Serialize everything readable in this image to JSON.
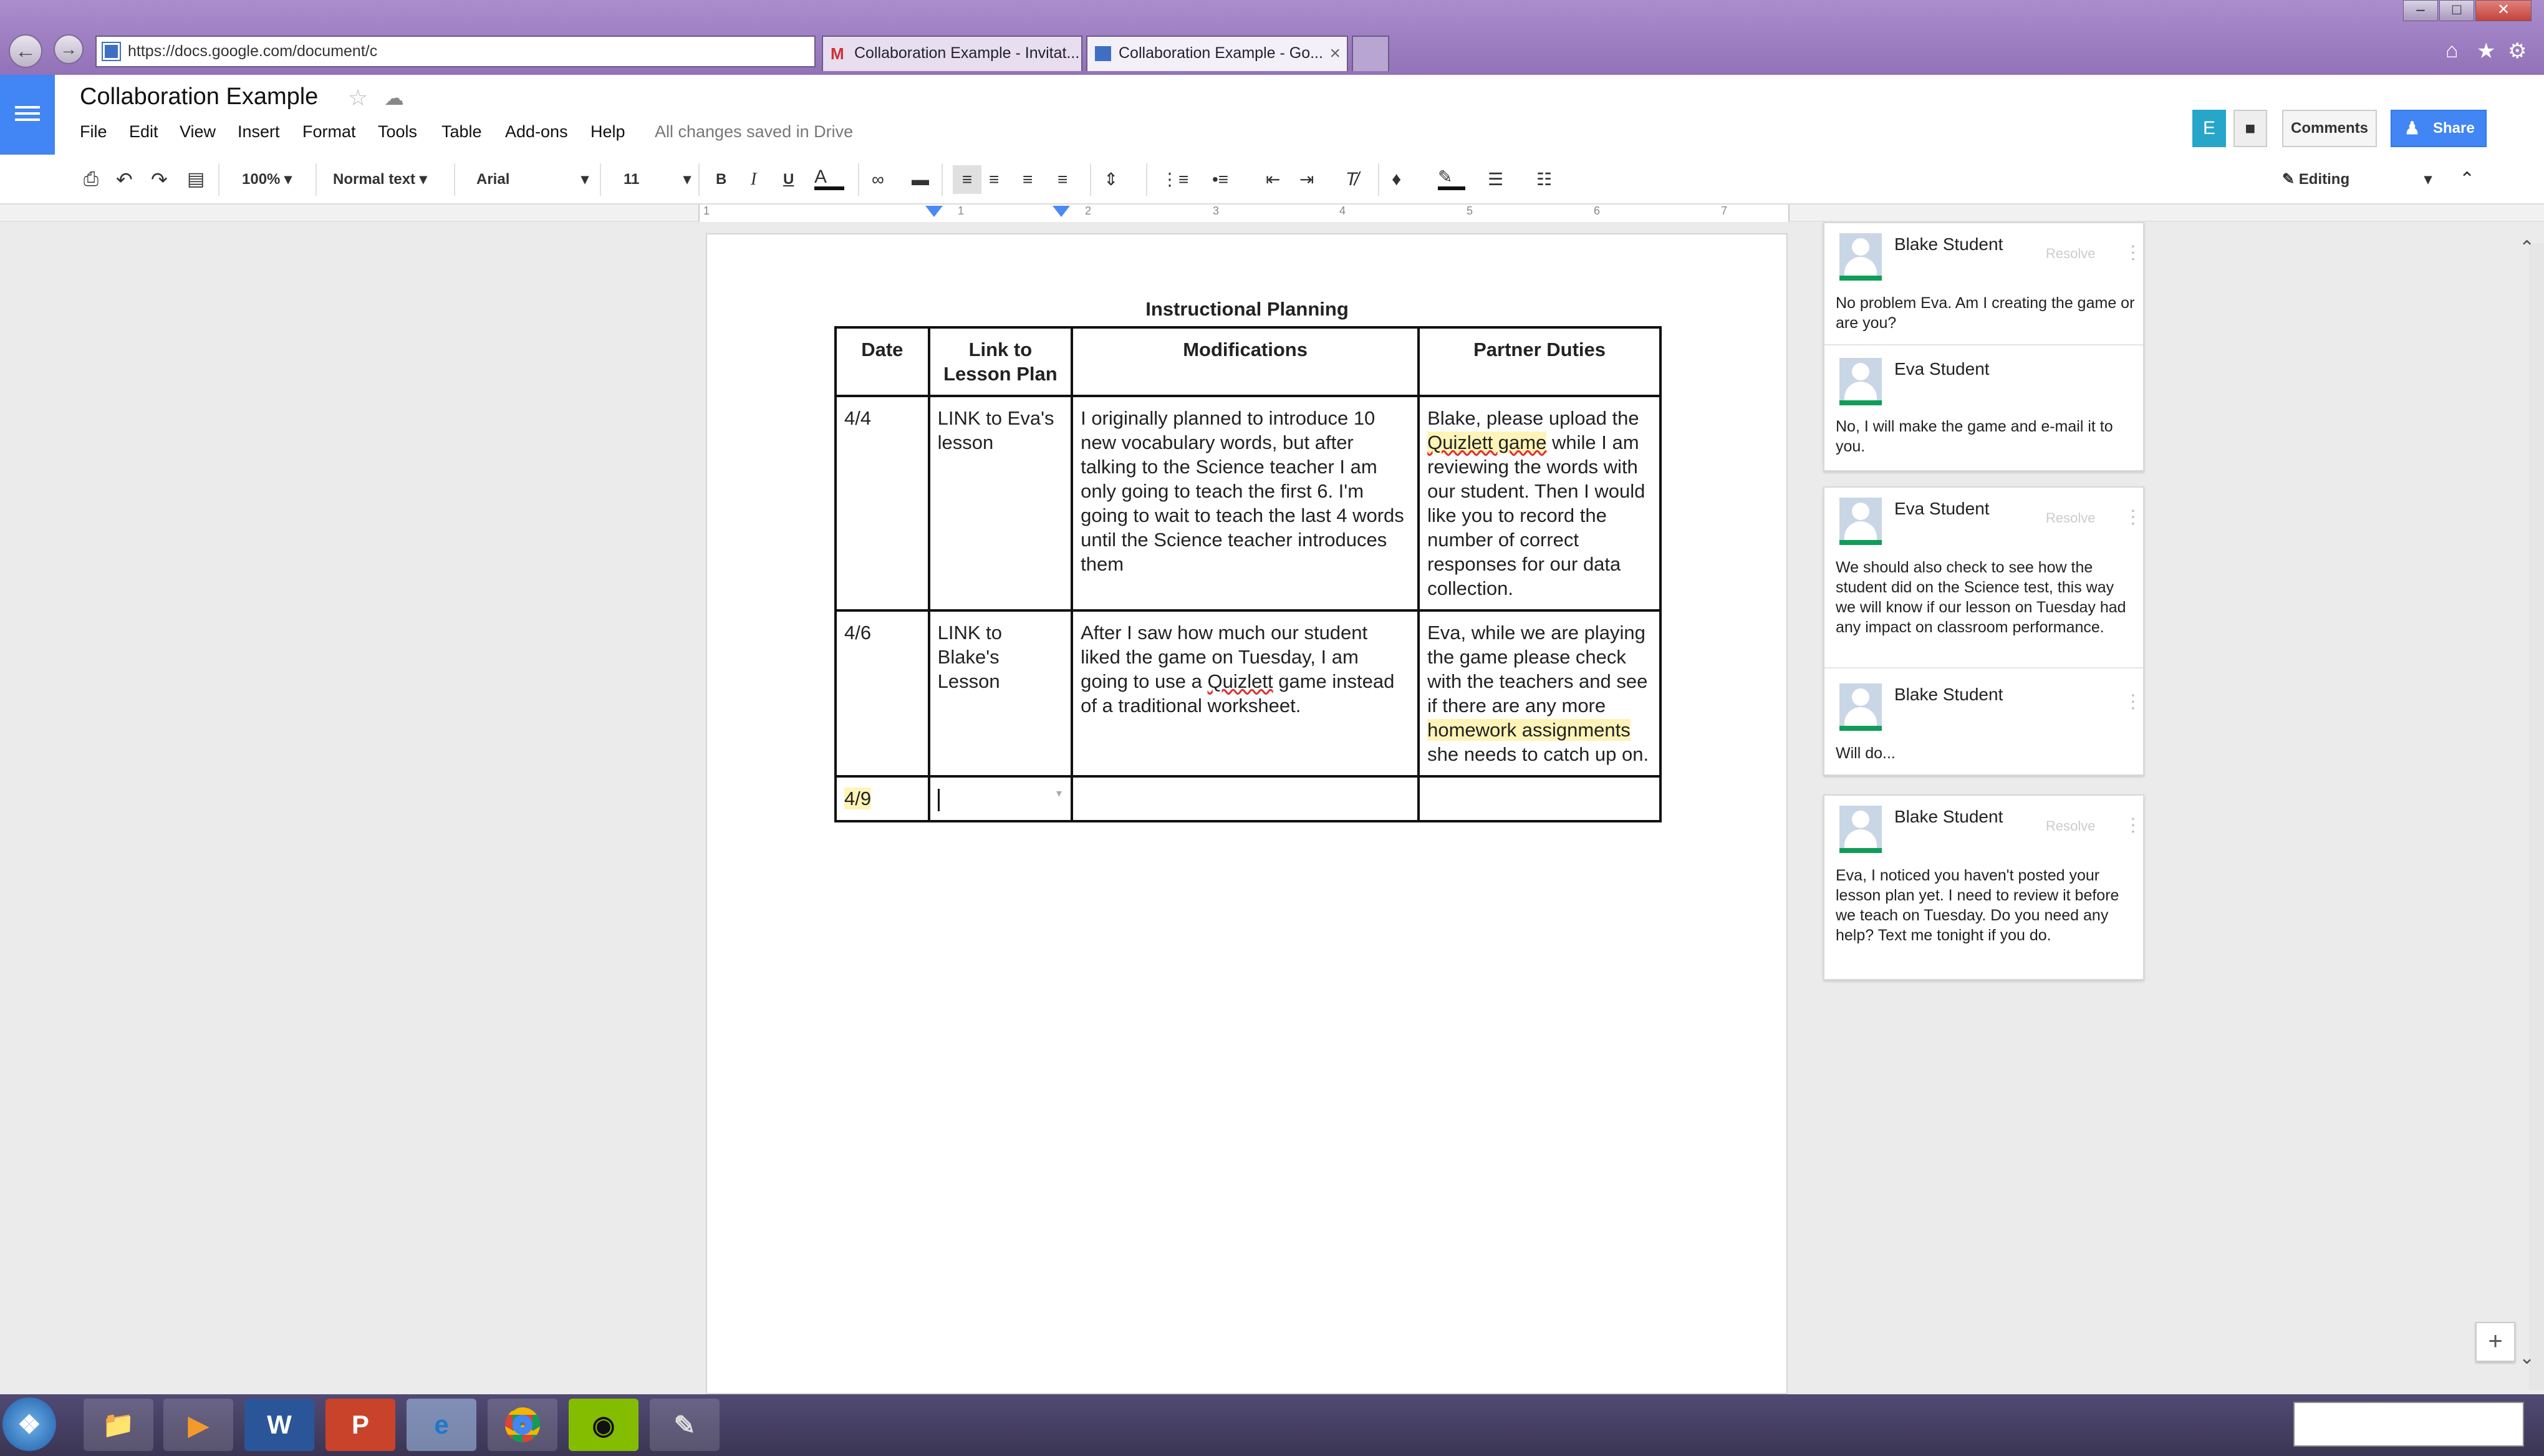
{
  "browser": {
    "url": "https://docs.google.com/document/c",
    "tabs": [
      {
        "title": "Collaboration Example - Invitat...",
        "icon": "gmail-icon"
      },
      {
        "title": "Collaboration Example - Go...",
        "icon": "docs-icon",
        "close": "×"
      }
    ]
  },
  "docs": {
    "title": "Collaboration Example",
    "menu": [
      "File",
      "Edit",
      "View",
      "Insert",
      "Format",
      "Tools",
      "Table",
      "Add-ons",
      "Help"
    ],
    "save_status": "All changes saved in Drive",
    "user_initial": "E",
    "comments_label": "Comments",
    "share_label": "Share"
  },
  "toolbar": {
    "zoom": "100%",
    "style": "Normal text",
    "font": "Arial",
    "size": "11",
    "bold": "B",
    "italic": "I",
    "underline": "U",
    "text_color": "A",
    "mode": "Editing"
  },
  "ruler": {
    "numbers": [
      "1",
      "1",
      "2",
      "3",
      "4",
      "5",
      "6",
      "7"
    ]
  },
  "document": {
    "table_title": "Instructional Planning",
    "headers": [
      "Date",
      "Link to Lesson Plan",
      "Modifications",
      "Partner Duties"
    ],
    "rows": [
      {
        "date": "4/4",
        "link": "LINK to Eva's lesson",
        "modifications": "I originally planned to introduce 10 new vocabulary words, but after talking to the Science teacher I am only going to teach the first 6.  I'm going to wait to teach the last 4 words until the Science teacher introduces them",
        "duties_pre": "Blake, please upload the ",
        "duties_highlight": "Quizlett game",
        "duties_post": " while I am reviewing the words with our student.  Then I would like you to record the number of correct responses for our data collection."
      },
      {
        "date": "4/6",
        "link": "LINK to Blake's Lesson",
        "modifications_pre": "After I saw how much our student liked the game on Tuesday, I am going to use a ",
        "modifications_squiggle": "Quizlett",
        "modifications_post": " game instead of a traditional worksheet.",
        "duties_pre": "Eva, while we are playing the game please check with the teachers and see if there are any more ",
        "duties_highlight": "homework assignments",
        "duties_post": " she needs to catch up on."
      },
      {
        "date": "4/9",
        "link": "",
        "modifications": "",
        "duties": ""
      }
    ]
  },
  "comments": [
    {
      "author": "Blake Student",
      "resolve": "Resolve",
      "text": "No problem Eva. Am I creating the game or are you?"
    },
    {
      "author": "Eva Student",
      "text": "No, I will make the game and e-mail it to you."
    },
    {
      "author": "Eva Student",
      "resolve": "Resolve",
      "text": "We should also check to see how the student did on the Science test, this way we will know if our lesson on Tuesday had any impact on classroom performance."
    },
    {
      "author": "Blake Student",
      "text": "Will do..."
    },
    {
      "author": "Blake Student",
      "resolve": "Resolve",
      "text": "Eva, I noticed you haven't posted your lesson plan yet. I need to review it before we teach on Tuesday. Do you need any help? Text me tonight if you do."
    }
  ],
  "taskbar": {
    "apps": [
      "start-orb-icon",
      "file-explorer-icon",
      "media-player-icon",
      "word-icon",
      "powerpoint-icon",
      "internet-explorer-icon",
      "chrome-icon",
      "spotify-icon",
      "paint-icon"
    ],
    "word_label": "W",
    "ppt_label": "P"
  },
  "colors": {
    "chrome": "#9f81c5",
    "docs_blue": "#4285f4",
    "share_blue": "#4285f4",
    "highlight": "#fff4b8",
    "avatar_bar": "#0f9d58"
  }
}
